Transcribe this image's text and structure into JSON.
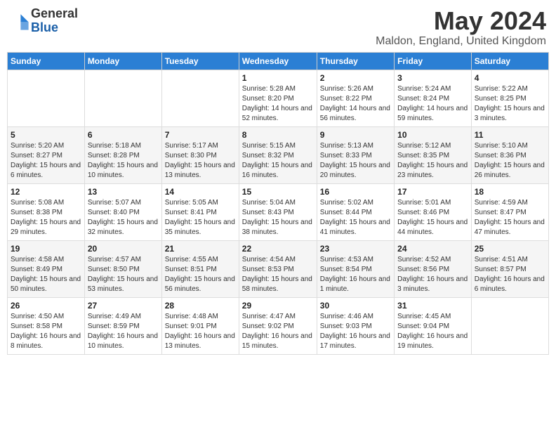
{
  "header": {
    "logo_general": "General",
    "logo_blue": "Blue",
    "month_title": "May 2024",
    "location": "Maldon, England, United Kingdom"
  },
  "weekdays": [
    "Sunday",
    "Monday",
    "Tuesday",
    "Wednesday",
    "Thursday",
    "Friday",
    "Saturday"
  ],
  "weeks": [
    [
      {
        "day": "",
        "sunrise": "",
        "sunset": "",
        "daylight": ""
      },
      {
        "day": "",
        "sunrise": "",
        "sunset": "",
        "daylight": ""
      },
      {
        "day": "",
        "sunrise": "",
        "sunset": "",
        "daylight": ""
      },
      {
        "day": "1",
        "sunrise": "Sunrise: 5:28 AM",
        "sunset": "Sunset: 8:20 PM",
        "daylight": "Daylight: 14 hours and 52 minutes."
      },
      {
        "day": "2",
        "sunrise": "Sunrise: 5:26 AM",
        "sunset": "Sunset: 8:22 PM",
        "daylight": "Daylight: 14 hours and 56 minutes."
      },
      {
        "day": "3",
        "sunrise": "Sunrise: 5:24 AM",
        "sunset": "Sunset: 8:24 PM",
        "daylight": "Daylight: 14 hours and 59 minutes."
      },
      {
        "day": "4",
        "sunrise": "Sunrise: 5:22 AM",
        "sunset": "Sunset: 8:25 PM",
        "daylight": "Daylight: 15 hours and 3 minutes."
      }
    ],
    [
      {
        "day": "5",
        "sunrise": "Sunrise: 5:20 AM",
        "sunset": "Sunset: 8:27 PM",
        "daylight": "Daylight: 15 hours and 6 minutes."
      },
      {
        "day": "6",
        "sunrise": "Sunrise: 5:18 AM",
        "sunset": "Sunset: 8:28 PM",
        "daylight": "Daylight: 15 hours and 10 minutes."
      },
      {
        "day": "7",
        "sunrise": "Sunrise: 5:17 AM",
        "sunset": "Sunset: 8:30 PM",
        "daylight": "Daylight: 15 hours and 13 minutes."
      },
      {
        "day": "8",
        "sunrise": "Sunrise: 5:15 AM",
        "sunset": "Sunset: 8:32 PM",
        "daylight": "Daylight: 15 hours and 16 minutes."
      },
      {
        "day": "9",
        "sunrise": "Sunrise: 5:13 AM",
        "sunset": "Sunset: 8:33 PM",
        "daylight": "Daylight: 15 hours and 20 minutes."
      },
      {
        "day": "10",
        "sunrise": "Sunrise: 5:12 AM",
        "sunset": "Sunset: 8:35 PM",
        "daylight": "Daylight: 15 hours and 23 minutes."
      },
      {
        "day": "11",
        "sunrise": "Sunrise: 5:10 AM",
        "sunset": "Sunset: 8:36 PM",
        "daylight": "Daylight: 15 hours and 26 minutes."
      }
    ],
    [
      {
        "day": "12",
        "sunrise": "Sunrise: 5:08 AM",
        "sunset": "Sunset: 8:38 PM",
        "daylight": "Daylight: 15 hours and 29 minutes."
      },
      {
        "day": "13",
        "sunrise": "Sunrise: 5:07 AM",
        "sunset": "Sunset: 8:40 PM",
        "daylight": "Daylight: 15 hours and 32 minutes."
      },
      {
        "day": "14",
        "sunrise": "Sunrise: 5:05 AM",
        "sunset": "Sunset: 8:41 PM",
        "daylight": "Daylight: 15 hours and 35 minutes."
      },
      {
        "day": "15",
        "sunrise": "Sunrise: 5:04 AM",
        "sunset": "Sunset: 8:43 PM",
        "daylight": "Daylight: 15 hours and 38 minutes."
      },
      {
        "day": "16",
        "sunrise": "Sunrise: 5:02 AM",
        "sunset": "Sunset: 8:44 PM",
        "daylight": "Daylight: 15 hours and 41 minutes."
      },
      {
        "day": "17",
        "sunrise": "Sunrise: 5:01 AM",
        "sunset": "Sunset: 8:46 PM",
        "daylight": "Daylight: 15 hours and 44 minutes."
      },
      {
        "day": "18",
        "sunrise": "Sunrise: 4:59 AM",
        "sunset": "Sunset: 8:47 PM",
        "daylight": "Daylight: 15 hours and 47 minutes."
      }
    ],
    [
      {
        "day": "19",
        "sunrise": "Sunrise: 4:58 AM",
        "sunset": "Sunset: 8:49 PM",
        "daylight": "Daylight: 15 hours and 50 minutes."
      },
      {
        "day": "20",
        "sunrise": "Sunrise: 4:57 AM",
        "sunset": "Sunset: 8:50 PM",
        "daylight": "Daylight: 15 hours and 53 minutes."
      },
      {
        "day": "21",
        "sunrise": "Sunrise: 4:55 AM",
        "sunset": "Sunset: 8:51 PM",
        "daylight": "Daylight: 15 hours and 56 minutes."
      },
      {
        "day": "22",
        "sunrise": "Sunrise: 4:54 AM",
        "sunset": "Sunset: 8:53 PM",
        "daylight": "Daylight: 15 hours and 58 minutes."
      },
      {
        "day": "23",
        "sunrise": "Sunrise: 4:53 AM",
        "sunset": "Sunset: 8:54 PM",
        "daylight": "Daylight: 16 hours and 1 minute."
      },
      {
        "day": "24",
        "sunrise": "Sunrise: 4:52 AM",
        "sunset": "Sunset: 8:56 PM",
        "daylight": "Daylight: 16 hours and 3 minutes."
      },
      {
        "day": "25",
        "sunrise": "Sunrise: 4:51 AM",
        "sunset": "Sunset: 8:57 PM",
        "daylight": "Daylight: 16 hours and 6 minutes."
      }
    ],
    [
      {
        "day": "26",
        "sunrise": "Sunrise: 4:50 AM",
        "sunset": "Sunset: 8:58 PM",
        "daylight": "Daylight: 16 hours and 8 minutes."
      },
      {
        "day": "27",
        "sunrise": "Sunrise: 4:49 AM",
        "sunset": "Sunset: 8:59 PM",
        "daylight": "Daylight: 16 hours and 10 minutes."
      },
      {
        "day": "28",
        "sunrise": "Sunrise: 4:48 AM",
        "sunset": "Sunset: 9:01 PM",
        "daylight": "Daylight: 16 hours and 13 minutes."
      },
      {
        "day": "29",
        "sunrise": "Sunrise: 4:47 AM",
        "sunset": "Sunset: 9:02 PM",
        "daylight": "Daylight: 16 hours and 15 minutes."
      },
      {
        "day": "30",
        "sunrise": "Sunrise: 4:46 AM",
        "sunset": "Sunset: 9:03 PM",
        "daylight": "Daylight: 16 hours and 17 minutes."
      },
      {
        "day": "31",
        "sunrise": "Sunrise: 4:45 AM",
        "sunset": "Sunset: 9:04 PM",
        "daylight": "Daylight: 16 hours and 19 minutes."
      },
      {
        "day": "",
        "sunrise": "",
        "sunset": "",
        "daylight": ""
      }
    ]
  ]
}
